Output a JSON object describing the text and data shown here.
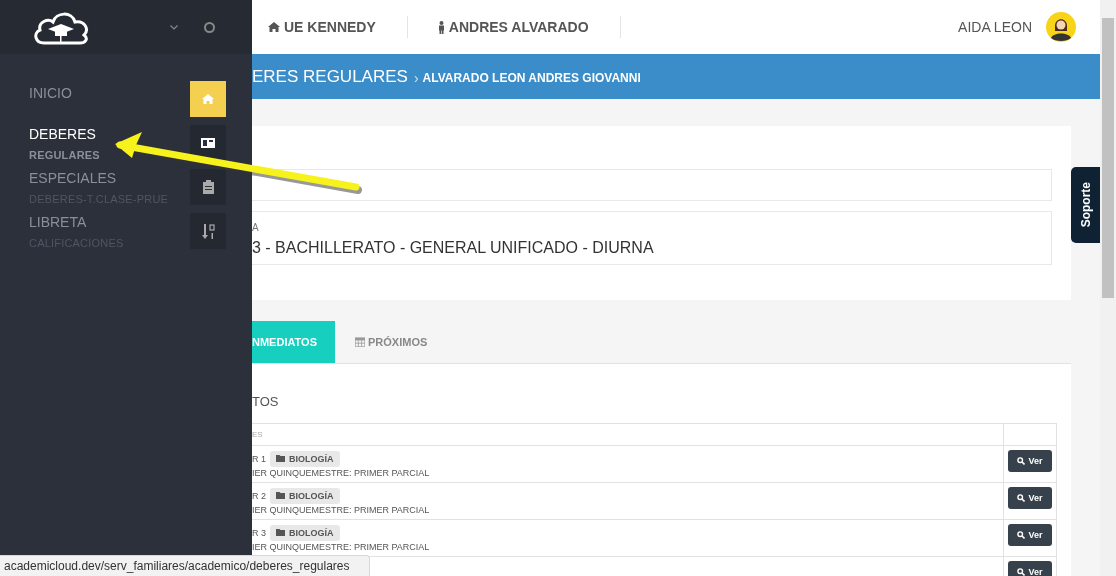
{
  "sidebar": {
    "items": [
      {
        "label": "INICIO",
        "selected": false
      },
      {
        "label": "DEBERES",
        "selected": true,
        "children": [
          {
            "label": "REGULARES",
            "selected": true
          }
        ]
      },
      {
        "label": "ESPECIALES",
        "selected": false,
        "children": [
          {
            "label": "DEBERES-T.CLASE-PRUE",
            "selected": false
          }
        ]
      },
      {
        "label": "LIBRETA",
        "selected": false,
        "children": [
          {
            "label": "CALIFICACIONES",
            "selected": false
          }
        ]
      }
    ],
    "icon_rail": [
      {
        "selected": true
      },
      {
        "selected": false
      },
      {
        "selected": false
      },
      {
        "selected": false
      }
    ]
  },
  "header": {
    "school": "UE KENNEDY",
    "student": "ANDRES ALVARADO",
    "user": "AIDA LEON"
  },
  "breadcrumb": {
    "section": "ERES REGULARES",
    "separator": "›",
    "current": "ALVARADO LEON ANDRES GIOVANNI"
  },
  "info_card": {
    "fields": [
      {
        "label": "A",
        "value": "3 - BACHILLERATO - GENERAL UNIFICADO - DIURNA"
      }
    ]
  },
  "tabs": [
    {
      "label": "NMEDIATOS",
      "selected": true
    },
    {
      "label": "PRÓXIMOS",
      "selected": false
    }
  ],
  "panel_title": "TOS",
  "table": {
    "columns": [
      "ES"
    ],
    "rows": [
      {
        "title": "R 1",
        "subject": "BIOLOGÍA",
        "period": "IER QUINQUEMESTRE: PRIMER PARCIAL",
        "action": "Ver"
      },
      {
        "title": "R 2",
        "subject": "BIOLOGÍA",
        "period": "IER QUINQUEMESTRE: PRIMER PARCIAL",
        "action": "Ver"
      },
      {
        "title": "R 3",
        "subject": "BIOLOGÍA",
        "period": "IER QUINQUEMESTRE: PRIMER PARCIAL",
        "action": "Ver"
      },
      {
        "action": "Ver"
      }
    ]
  },
  "support_tab": "Soporte",
  "status_url": "academicloud.dev/serv_familiares/academico/deberes_regulares"
}
